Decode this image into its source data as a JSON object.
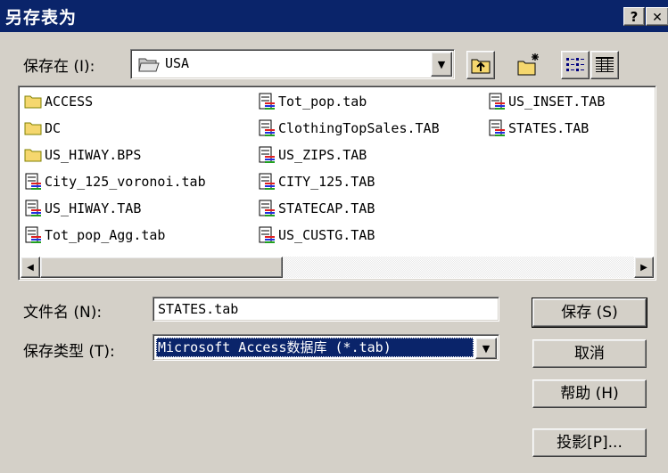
{
  "window": {
    "title": "另存表为",
    "help_button": "?",
    "close_button": "✕"
  },
  "save_in": {
    "label": "保存在 (I):",
    "value": "USA"
  },
  "toolbar": {
    "up_folder": "up-one-level",
    "new_folder": "create-new-folder",
    "list_view": "list-view",
    "details_view": "details-view"
  },
  "files": {
    "col1": [
      {
        "name": "ACCESS",
        "type": "folder"
      },
      {
        "name": "DC",
        "type": "folder"
      },
      {
        "name": "US_HIWAY.BPS",
        "type": "folder"
      },
      {
        "name": "City_125_voronoi.tab",
        "type": "table"
      },
      {
        "name": "US_HIWAY.TAB",
        "type": "table"
      },
      {
        "name": "Tot_pop_Agg.tab",
        "type": "table"
      }
    ],
    "col2": [
      {
        "name": "Tot_pop.tab",
        "type": "table"
      },
      {
        "name": "ClothingTopSales.TAB",
        "type": "table"
      },
      {
        "name": "US_ZIPS.TAB",
        "type": "table"
      },
      {
        "name": "CITY_125.TAB",
        "type": "table"
      },
      {
        "name": "STATECAP.TAB",
        "type": "table"
      },
      {
        "name": "US_CUSTG.TAB",
        "type": "table"
      }
    ],
    "col3": [
      {
        "name": "US_INSET.TAB",
        "type": "table"
      },
      {
        "name": "STATES.TAB",
        "type": "table"
      }
    ]
  },
  "filename": {
    "label": "文件名 (N):",
    "value": "STATES.tab"
  },
  "filetype": {
    "label": "保存类型 (T):",
    "value": "Microsoft Access数据库 (*.tab)"
  },
  "buttons": {
    "save": "保存 (S)",
    "cancel": "取消",
    "help": "帮助 (H)",
    "projection": "投影[P]..."
  },
  "colors": {
    "titlebar": "#0a246a",
    "face": "#d4d0c8",
    "folder": "#f5d76e"
  }
}
